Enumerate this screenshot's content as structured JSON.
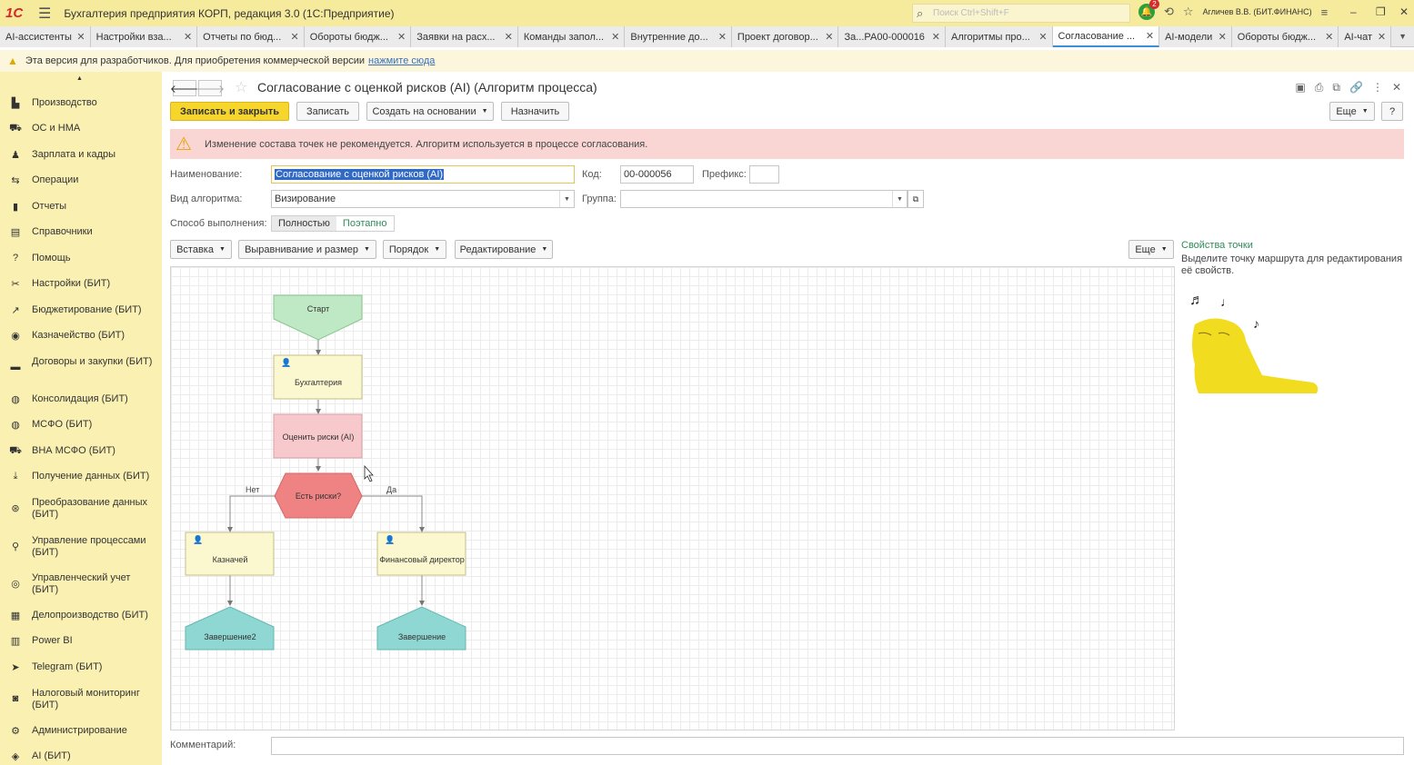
{
  "titlebar": {
    "logo": "1С",
    "app_title": "Бухгалтерия предприятия КОРП, редакция 3.0  (1С:Предприятие)",
    "search_placeholder": "Поиск Ctrl+Shift+F",
    "notifications_count": "2",
    "user": "Агличев В.В. (БИТ.ФИНАНС)"
  },
  "tabs": [
    {
      "label": "AI-ассистенты"
    },
    {
      "label": "Настройки вза..."
    },
    {
      "label": "Отчеты по бюд..."
    },
    {
      "label": "Обороты бюдж..."
    },
    {
      "label": "Заявки на расх..."
    },
    {
      "label": "Команды запол..."
    },
    {
      "label": "Внутренние до..."
    },
    {
      "label": "Проект договор..."
    },
    {
      "label": "За...РА00-000016"
    },
    {
      "label": "Алгоритмы про..."
    },
    {
      "label": "Согласование ..."
    },
    {
      "label": "AI-модели"
    },
    {
      "label": "Обороты бюдж..."
    },
    {
      "label": "AI-чат"
    }
  ],
  "devbar": {
    "message": "Эта версия для разработчиков. Для приобретения коммерческой версии",
    "link": "нажмите сюда"
  },
  "sidebar": {
    "items": [
      {
        "label": "Производство",
        "icon": "factory-icon"
      },
      {
        "label": "ОС и НМА",
        "icon": "truck-icon"
      },
      {
        "label": "Зарплата и кадры",
        "icon": "person-icon"
      },
      {
        "label": "Операции",
        "icon": "operations-icon"
      },
      {
        "label": "Отчеты",
        "icon": "bar-chart-icon"
      },
      {
        "label": "Справочники",
        "icon": "book-icon"
      },
      {
        "label": "Помощь",
        "icon": "question-icon"
      },
      {
        "label": "Настройки (БИТ)",
        "icon": "tools-icon"
      },
      {
        "label": "Бюджетирование (БИТ)",
        "icon": "trend-icon"
      },
      {
        "label": "Казначейство (БИТ)",
        "icon": "coins-icon"
      },
      {
        "label": "Договоры и закупки (БИТ)",
        "icon": "folder-icon"
      },
      {
        "label": "Консолидация (БИТ)",
        "icon": "globe-icon"
      },
      {
        "label": "МСФО (БИТ)",
        "icon": "globe-icon"
      },
      {
        "label": "ВНА МСФО (БИТ)",
        "icon": "truck-icon"
      },
      {
        "label": "Получение данных (БИТ)",
        "icon": "download-icon"
      },
      {
        "label": "Преобразование данных (БИТ)",
        "icon": "transform-icon"
      },
      {
        "label": "Управление процессами (БИТ)",
        "icon": "process-icon"
      },
      {
        "label": "Управленческий учет (БИТ)",
        "icon": "target-icon"
      },
      {
        "label": "Делопроизводство (БИТ)",
        "icon": "documents-icon"
      },
      {
        "label": "Power BI",
        "icon": "powerbi-icon"
      },
      {
        "label": "Telegram (БИТ)",
        "icon": "telegram-icon"
      },
      {
        "label": "Налоговый мониторинг (БИТ)",
        "icon": "monitor-icon"
      },
      {
        "label": "Администрирование",
        "icon": "gear-icon"
      },
      {
        "label": "AI (БИТ)",
        "icon": "ai-icon"
      }
    ]
  },
  "form": {
    "title": "Согласование с оценкой рисков (AI) (Алгоритм процесса)",
    "buttons": {
      "save_close": "Записать и закрыть",
      "save": "Записать",
      "create_based": "Создать на основании",
      "assign": "Назначить",
      "more": "Еще",
      "help": "?"
    },
    "alert": "Изменение состава точек не рекомендуется. Алгоритм используется в процессе согласования.",
    "fields": {
      "name_label": "Наименование:",
      "name_value": "Согласование с оценкой рисков (AI)",
      "code_label": "Код:",
      "code_value": "00-000056",
      "prefix_label": "Префикс:",
      "prefix_value": "",
      "kind_label": "Вид алгоритма:",
      "kind_value": "Визирование",
      "group_label": "Группа:",
      "group_value": "",
      "mode_label": "Способ выполнения:",
      "mode_options": [
        "Полностью",
        "Поэтапно"
      ],
      "mode_selected": "Полностью"
    },
    "toolbar": {
      "insert": "Вставка",
      "align": "Выравнивание и размер",
      "order": "Порядок",
      "edit": "Редактирование",
      "more": "Еще"
    },
    "right_panel": {
      "title": "Свойства точки",
      "hint": "Выделите точку маршрута для редактирования её свойств."
    },
    "comment_label": "Комментарий:",
    "comment_value": ""
  },
  "flow": {
    "nodes": {
      "start": "Старт",
      "accounting": "Бухгалтерия",
      "assess": "Оценить риски (AI)",
      "decision": "Есть риски?",
      "treasurer": "Казначей",
      "cfo": "Финансовый директор",
      "end2": "Завершение2",
      "end": "Завершение"
    },
    "edges": {
      "no": "Нет",
      "yes": "Да"
    },
    "colors": {
      "start": "#bfe8c4",
      "task": "#fbf8cf",
      "ai_task": "#f7c9cc",
      "decision": "#ef8383",
      "end": "#8fd7d2"
    }
  }
}
